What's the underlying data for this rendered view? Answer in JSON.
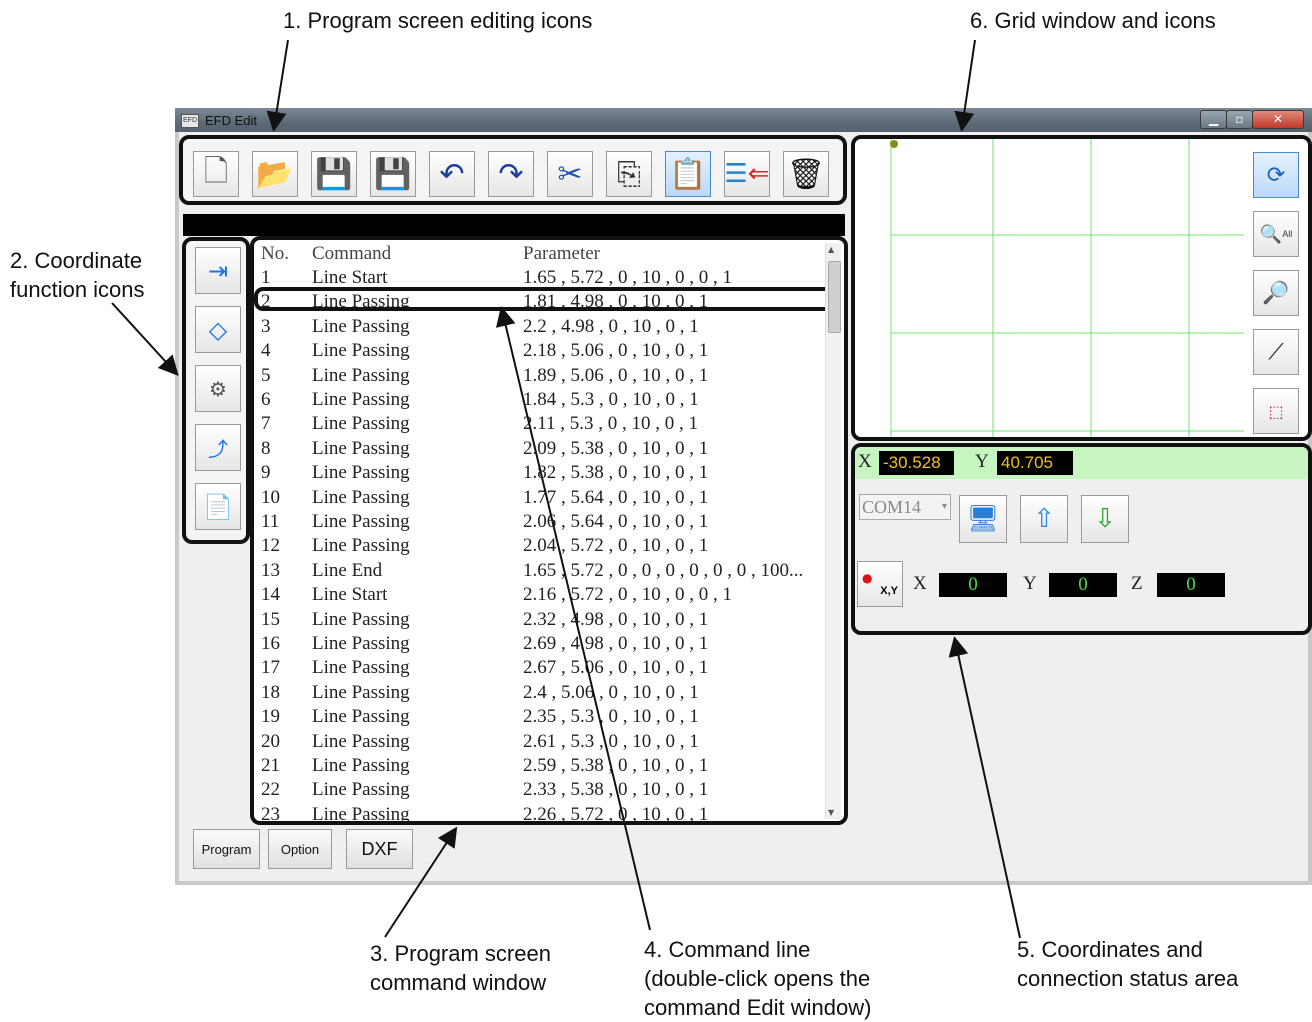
{
  "callouts": {
    "c1": "1. Program screen editing icons",
    "c2": [
      "2. Coordinate",
      "function icons"
    ],
    "c3": [
      "3. Program screen",
      "command window"
    ],
    "c4": [
      "4. Command line",
      "(double-click opens the",
      "command Edit window)"
    ],
    "c5": [
      "5. Coordinates and",
      "connection status area"
    ],
    "c6": "6. Grid window and icons"
  },
  "window": {
    "title": "EFD Edit",
    "icon": "EFD",
    "controls": [
      "minimize-icon",
      "maximize-icon",
      "close-icon"
    ]
  },
  "toolbar_icons": [
    "new-file-icon",
    "open-folder-icon",
    "save-icon",
    "save-as-icon",
    "undo-icon",
    "redo-icon",
    "cut-icon",
    "copy-icon",
    "paste-icon",
    "insert-icon",
    "delete-icon"
  ],
  "coord_icons": [
    "teach-point-icon",
    "measure-icon",
    "z-settings-icon",
    "xyz-move-icon",
    "export-icon"
  ],
  "list": {
    "headers": {
      "no": "No.",
      "command": "Command",
      "parameter": "Parameter"
    },
    "rows": [
      {
        "no": "1",
        "command": "Line Start",
        "param": "1.65 , 5.72 , 0 , 10 , 0 , 0 , 1"
      },
      {
        "no": "2",
        "command": "Line Passing",
        "param": "1.81 , 4.98 , 0 , 10 , 0 , 1"
      },
      {
        "no": "3",
        "command": "Line Passing",
        "param": "2.2 , 4.98 , 0 , 10 , 0 , 1"
      },
      {
        "no": "4",
        "command": "Line Passing",
        "param": "2.18 , 5.06 , 0 , 10 , 0 , 1"
      },
      {
        "no": "5",
        "command": "Line Passing",
        "param": "1.89 , 5.06 , 0 , 10 , 0 , 1"
      },
      {
        "no": "6",
        "command": "Line Passing",
        "param": "1.84 , 5.3 , 0 , 10 , 0 , 1"
      },
      {
        "no": "7",
        "command": "Line Passing",
        "param": "2.11 , 5.3 , 0 , 10 , 0 , 1"
      },
      {
        "no": "8",
        "command": "Line Passing",
        "param": "2.09 , 5.38 , 0 , 10 , 0 , 1"
      },
      {
        "no": "9",
        "command": "Line Passing",
        "param": "1.82 , 5.38 , 0 , 10 , 0 , 1"
      },
      {
        "no": "10",
        "command": "Line Passing",
        "param": "1.77 , 5.64 , 0 , 10 , 0 , 1"
      },
      {
        "no": "11",
        "command": "Line Passing",
        "param": "2.06 , 5.64 , 0 , 10 , 0 , 1"
      },
      {
        "no": "12",
        "command": "Line Passing",
        "param": "2.04 , 5.72 , 0 , 10 , 0 , 1"
      },
      {
        "no": "13",
        "command": "Line End",
        "param": "1.65 , 5.72 , 0 , 0 , 0 , 0 , 0 , 0 , 100..."
      },
      {
        "no": "14",
        "command": "Line Start",
        "param": "2.16 , 5.72 , 0 , 10 , 0 , 0 , 1"
      },
      {
        "no": "15",
        "command": "Line Passing",
        "param": "2.32 , 4.98 , 0 , 10 , 0 , 1"
      },
      {
        "no": "16",
        "command": "Line Passing",
        "param": "2.69 , 4.98 , 0 , 10 , 0 , 1"
      },
      {
        "no": "17",
        "command": "Line Passing",
        "param": "2.67 , 5.06 , 0 , 10 , 0 , 1"
      },
      {
        "no": "18",
        "command": "Line Passing",
        "param": "2.4 , 5.06 , 0 , 10 , 0 , 1"
      },
      {
        "no": "19",
        "command": "Line Passing",
        "param": "2.35 , 5.3 , 0 , 10 , 0 , 1"
      },
      {
        "no": "20",
        "command": "Line Passing",
        "param": "2.61 , 5.3 , 0 , 10 , 0 , 1"
      },
      {
        "no": "21",
        "command": "Line Passing",
        "param": "2.59 , 5.38 , 0 , 10 , 0 , 1"
      },
      {
        "no": "22",
        "command": "Line Passing",
        "param": "2.33 , 5.38 , 0 , 10 , 0 , 1"
      },
      {
        "no": "23",
        "command": "Line Passing",
        "param": "2.26 , 5.72 , 0 , 10 , 0 , 1"
      }
    ],
    "selected_row": "2"
  },
  "bottom_buttons": {
    "program": "Program",
    "option": "Option",
    "dxf": "DXF"
  },
  "grid_icons": [
    "refresh-icon",
    "zoom-all-icon",
    "zoom-window-icon",
    "draw-line-icon",
    "select-area-icon"
  ],
  "zoom_all_label": "All",
  "status": {
    "x_label": "X",
    "x_value": "-30.528",
    "y_label": "Y",
    "y_value": "40.705",
    "com_port": "COM14",
    "xy_button_label": "X,Y",
    "pos": {
      "x_label": "X",
      "x": "0",
      "y_label": "Y",
      "y": "0",
      "z_label": "Z",
      "z": "0"
    }
  },
  "colors": {
    "grid_line": "#6fe36f",
    "grid_point": "#8a8a1a",
    "coord_strip": "#c6f5c0",
    "value_text": "#f0c020",
    "zero_text": "#3fe03f"
  }
}
